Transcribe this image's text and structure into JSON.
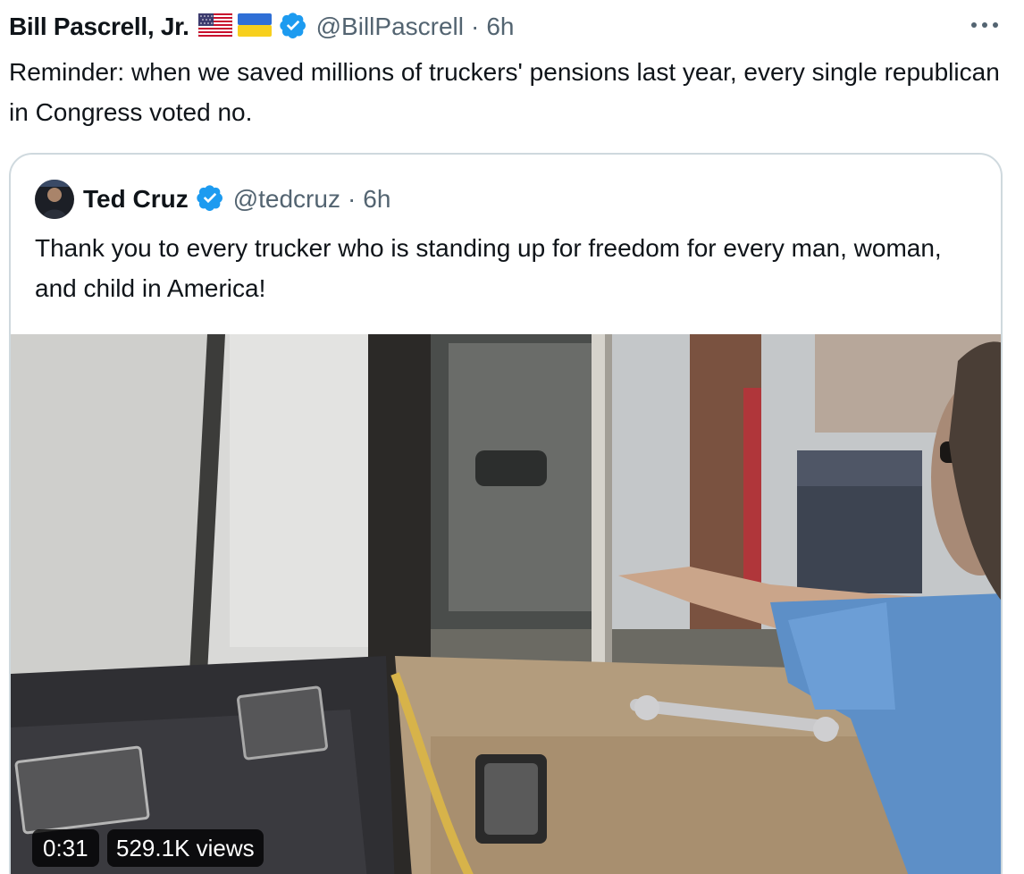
{
  "tweet": {
    "author": {
      "name": "Bill Pascrell, Jr.",
      "flags": [
        "us-flag-icon",
        "ukraine-flag-icon"
      ],
      "verified": true,
      "handle": "@BillPascrell",
      "separator": "·",
      "time": "6h"
    },
    "more_icon": "more-icon",
    "text": "Reminder: when we saved millions of truckers' pensions last year, every single republican in Congress voted no."
  },
  "quote": {
    "author": {
      "name": "Ted Cruz",
      "verified": true,
      "handle": "@tedcruz",
      "separator": "·",
      "time": "6h"
    },
    "text": "Thank you to every trucker who is standing up for freedom for every man, woman, and child in America!",
    "video": {
      "duration": "0:31",
      "views": "529.1K views"
    }
  },
  "colors": {
    "text": "#0f1419",
    "secondary": "#536471",
    "verified": "#1d9bf0",
    "border": "#cfd9de"
  }
}
